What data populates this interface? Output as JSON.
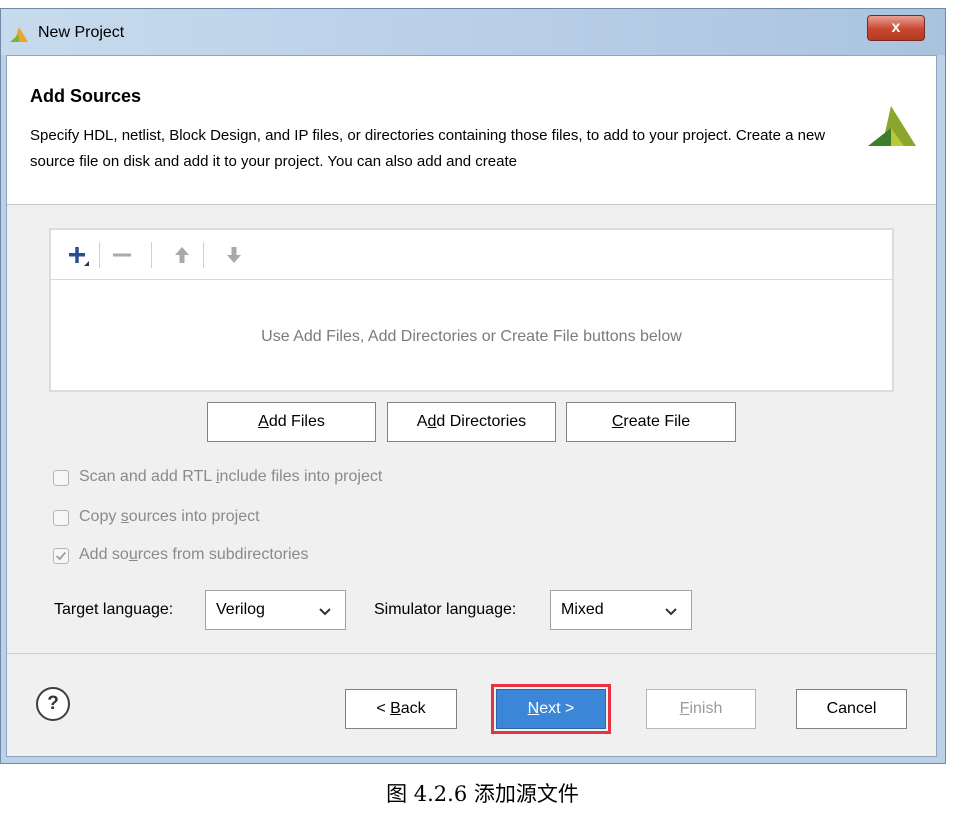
{
  "window": {
    "title": "New Project",
    "close_glyph": "x"
  },
  "header": {
    "title": "Add Sources",
    "description": "Specify HDL, netlist, Block Design, and IP files, or directories containing those files, to add to your project. Create a new source file on disk and add it to your project. You can also add and create"
  },
  "toolbar": {
    "icons": [
      "add-icon",
      "remove-icon",
      "move-up-icon",
      "move-down-icon"
    ]
  },
  "sources": {
    "empty_message": "Use Add Files, Add Directories or Create File buttons below"
  },
  "buttons": {
    "add_files": {
      "pre": "",
      "key": "A",
      "post": "dd Files"
    },
    "add_directories": {
      "pre": "A",
      "key": "d",
      "post": "d Directories"
    },
    "create_file": {
      "pre": "",
      "key": "C",
      "post": "reate File"
    }
  },
  "options": {
    "scan_rtl": {
      "pre": "Scan and add RTL ",
      "key": "i",
      "post": "nclude files into project",
      "checked": false
    },
    "copy_sources": {
      "pre": "Copy ",
      "key": "s",
      "post": "ources into project",
      "checked": false
    },
    "add_subdirs": {
      "pre": "Add so",
      "key": "u",
      "post": "rces from subdirectories",
      "checked": true
    }
  },
  "language": {
    "target_label": "Target language:",
    "target_value": "Verilog",
    "simulator_label": "Simulator language:",
    "simulator_value": "Mixed"
  },
  "footer": {
    "help": "?",
    "back": {
      "pre": "< ",
      "key": "B",
      "post": "ack"
    },
    "next": {
      "pre": "",
      "key": "N",
      "post": "ext >"
    },
    "finish": {
      "pre": "",
      "key": "F",
      "post": "inish"
    },
    "cancel": "Cancel"
  },
  "caption": "图  4.2.6  添加源文件",
  "colors": {
    "accent": "#3b86d6",
    "highlight": "#e7333f",
    "logo": "#7a9a2a"
  }
}
